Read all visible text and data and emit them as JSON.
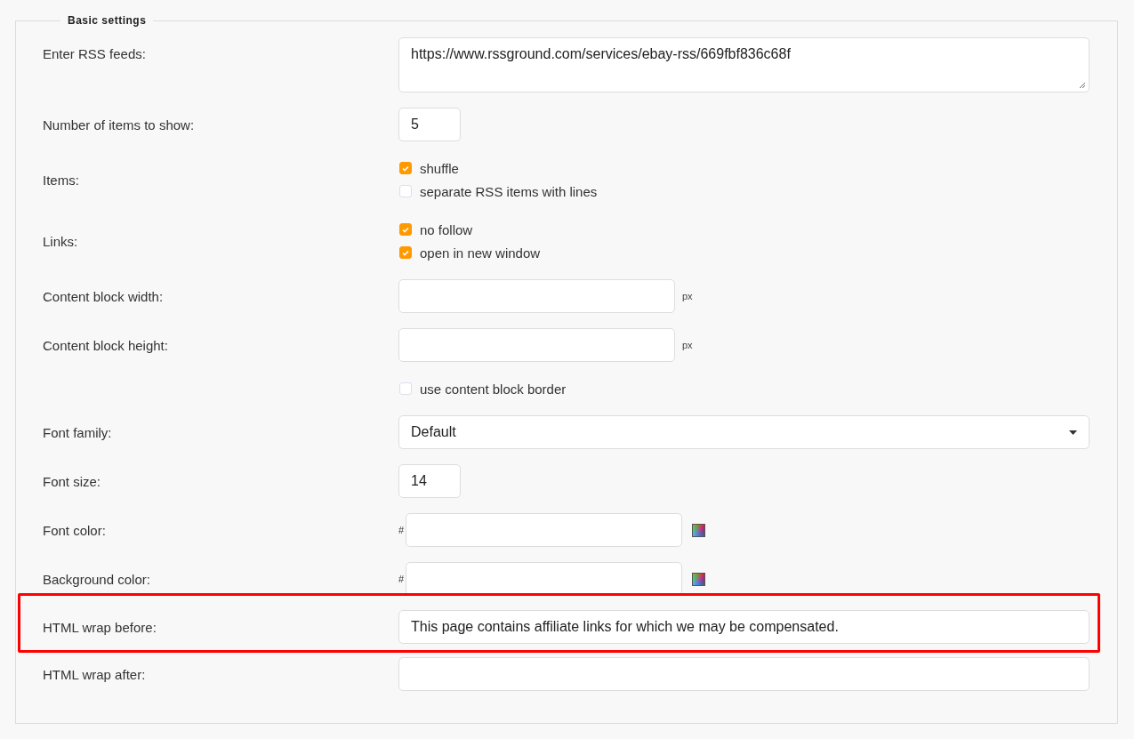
{
  "fieldset": {
    "legend": "Basic settings"
  },
  "rows": [
    {
      "kind": "textarea",
      "label": "Enter RSS feeds:",
      "value": "https://www.rssground.com/services/ebay-rss/669fbf836c68f",
      "highlighted": false
    },
    {
      "kind": "small-input",
      "label": "Number of items to show:",
      "value": "5",
      "highlighted": false
    },
    {
      "kind": "checkboxes",
      "label": "Items:",
      "highlighted": false,
      "options": [
        {
          "label": "shuffle",
          "checked": true
        },
        {
          "label": "separate RSS items with lines",
          "checked": false
        }
      ]
    },
    {
      "kind": "checkboxes",
      "label": "Links:",
      "highlighted": false,
      "options": [
        {
          "label": "no follow",
          "checked": true
        },
        {
          "label": "open in new window",
          "checked": true
        }
      ]
    },
    {
      "kind": "unit-input",
      "label": "Content block width:",
      "unit": "px",
      "highlighted": false
    },
    {
      "kind": "unit-input",
      "label": "Content block height:",
      "unit": "px",
      "highlighted": false
    },
    {
      "kind": "checkboxes",
      "highlighted": false,
      "options": [
        {
          "label": "use content block border",
          "checked": false
        }
      ]
    },
    {
      "kind": "select",
      "label": "Font family:",
      "value": "Default",
      "highlighted": false
    },
    {
      "kind": "small-input",
      "label": "Font size:",
      "value": "14",
      "highlighted": false
    },
    {
      "kind": "color",
      "label": "Font color:",
      "prefix": "#",
      "highlighted": false
    },
    {
      "kind": "color",
      "label": "Background color:",
      "prefix": "#",
      "highlighted": false
    },
    {
      "kind": "text",
      "label": "HTML wrap before:",
      "value": "This page contains affiliate links for which we may be compensated.",
      "highlighted": true
    },
    {
      "kind": "text",
      "label": "HTML wrap after:",
      "highlighted": false
    }
  ]
}
